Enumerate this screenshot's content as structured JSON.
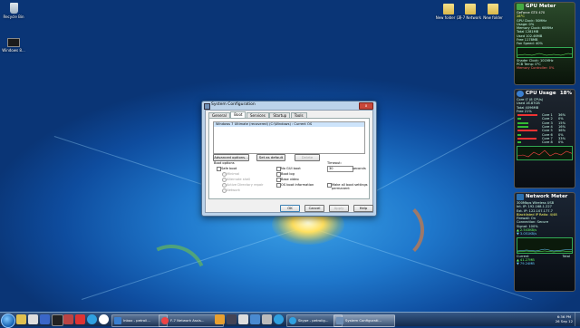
{
  "desktop": {
    "icons": [
      {
        "label": "Recycle Bin",
        "icon": "recycle-bin-icon"
      },
      {
        "label": "Windows 8...",
        "icon": "terminal-icon"
      },
      {
        "label": "New folder (2)",
        "icon": "folder-icon"
      },
      {
        "label": "F-7 Network",
        "icon": "folder-icon"
      },
      {
        "label": "New folder",
        "icon": "folder-icon"
      }
    ]
  },
  "dialog": {
    "title": "System Configuration",
    "close": "x",
    "tabs": [
      "General",
      "Boot",
      "Services",
      "Startup",
      "Tools"
    ],
    "active_tab": "Boot",
    "os_entry": "Windows 7 Ultimate (recovered) (C:\\Windows) : Current OS",
    "buttons": {
      "advanced": "Advanced options...",
      "set_default": "Set as default",
      "delete": "Delete",
      "ok": "OK",
      "cancel": "Cancel",
      "apply": "Apply",
      "help": "Help"
    },
    "boot_options_label": "Boot options",
    "safe_boot": "Safe boot",
    "safe_modes": [
      "Minimal",
      "Alternate shell",
      "Active Directory repair",
      "Network"
    ],
    "options": [
      "No GUI boot",
      "Boot log",
      "Base video",
      "OS boot information"
    ],
    "timeout_label": "Timeout:",
    "timeout_value": "30",
    "timeout_unit": "seconds",
    "permanent_label": "Make all boot settings permanent"
  },
  "gpu_gadget": {
    "title": "GPU Meter",
    "model": "GeForce GTX 470",
    "temp": "28°C",
    "lines": [
      "GPU Clock: 50MHz",
      "Usage: 0%",
      "Memory Clock: 68MHz",
      "Total 1281MB",
      "Used 102.46MB",
      "Free 1178MB",
      "Fan Speed: 40%",
      "Shader Clock: 101MHz",
      "PCB Temp: 0°C",
      "Memory Controller: 0%"
    ]
  },
  "cpu_gadget": {
    "title": "CPU Usage",
    "percent": "18%",
    "lines": [
      "Core i7 (8 CPUs)",
      "Used 16.87GB",
      "Total 4096MB",
      "Free 21%"
    ],
    "cores": [
      {
        "name": "Core 1",
        "value": "36%",
        "pct": 36
      },
      {
        "name": "Core 2",
        "value": "0%",
        "pct": 0
      },
      {
        "name": "Core 3",
        "value": "15%",
        "pct": 15
      },
      {
        "name": "Core 4",
        "value": "16%",
        "pct": 16
      },
      {
        "name": "Core 5",
        "value": "36%",
        "pct": 36
      },
      {
        "name": "Core 6",
        "value": "0%",
        "pct": 0
      },
      {
        "name": "Core 7",
        "value": "33%",
        "pct": 33
      },
      {
        "name": "Core 8",
        "value": "0%",
        "pct": 0
      }
    ]
  },
  "net_gadget": {
    "title": "Network Meter",
    "lines": [
      "300Mbps Wireless USB",
      "Int. IP: 192.168.1.227",
      "Ext. IP: 122.107.177.7",
      "Blacklisted IP Ratio: 4/48",
      "Firewall: On",
      "Connection: Secure",
      "Signal: 100%"
    ],
    "up": "2.543KB/s",
    "down": "3.051KB/s",
    "current_label": "Current",
    "total_label": "Total",
    "cur_up": "41.27MB",
    "cur_down": "79.24MB"
  },
  "taskbar": {
    "windows": [
      {
        "label": "Inbox - petroll...",
        "icon": "mail-icon",
        "active": false
      },
      {
        "label": "F-7 Network Assis...",
        "icon": "chrome-icon",
        "active": false
      },
      {
        "label": "Skype - petrolig...",
        "icon": "skype-icon",
        "active": false
      },
      {
        "label": "System Configurati...",
        "icon": "msconfig-icon",
        "active": true
      }
    ],
    "time": "6:36 PM",
    "date": "26 Sep 12"
  },
  "colors": {
    "accent": "#1f78cc",
    "dialog_frame": "#bcd3ea",
    "close_red": "#c8473a"
  }
}
